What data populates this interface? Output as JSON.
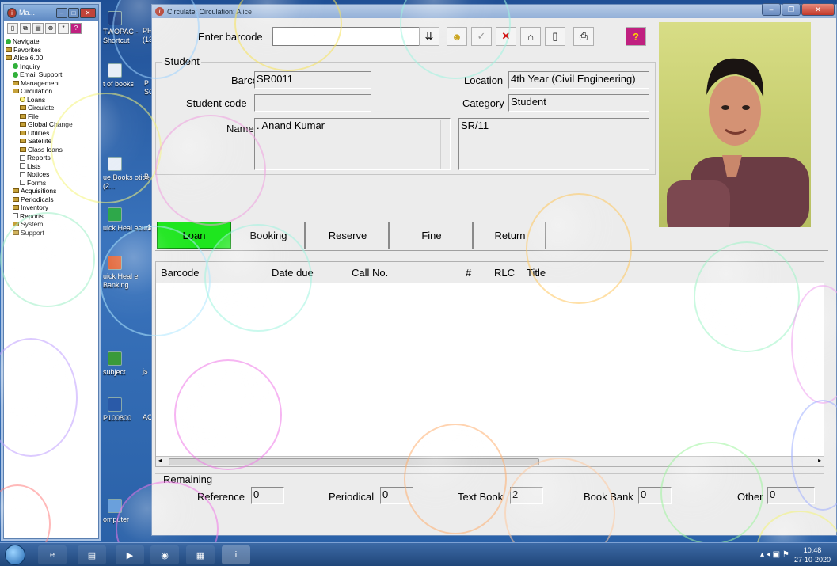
{
  "desktop": {
    "icons": [
      {
        "label": "TWOPAC - Shortcut",
        "extra": "PH (13"
      },
      {
        "label": "t of books",
        "extra": "P SO"
      },
      {
        "label": "ue Books otice (2...",
        "extra": "B"
      },
      {
        "label": "uick Heal ecure",
        "extra": "1"
      },
      {
        "label": "uick Heal e Banking",
        "extra": ""
      },
      {
        "label": "subject",
        "extra": "js"
      },
      {
        "label": "P100800",
        "extra": "AC"
      },
      {
        "label": "omputer",
        "extra": ""
      }
    ]
  },
  "tree_window": {
    "title": "Ma...",
    "items": [
      {
        "label": "Navigate",
        "icon": "green-dot-icon",
        "indent": 0
      },
      {
        "label": "Favorites",
        "icon": "folder-icon",
        "indent": 0
      },
      {
        "label": "Alice 6.00",
        "icon": "folder-icon",
        "indent": 0
      },
      {
        "label": "Inquiry",
        "icon": "green-dot-icon",
        "indent": 1
      },
      {
        "label": "Email Support",
        "icon": "green-dot-icon",
        "indent": 1
      },
      {
        "label": "Management",
        "icon": "folder-icon",
        "indent": 1
      },
      {
        "label": "Circulation",
        "icon": "folder-icon",
        "indent": 1
      },
      {
        "label": "Loans",
        "icon": "yellow-circle-icon",
        "indent": 2
      },
      {
        "label": "Circulate",
        "icon": "folder-icon",
        "indent": 2
      },
      {
        "label": "File",
        "icon": "folder-icon",
        "indent": 2
      },
      {
        "label": "Global Change",
        "icon": "folder-icon",
        "indent": 2
      },
      {
        "label": "Utilities",
        "icon": "folder-icon",
        "indent": 2
      },
      {
        "label": "Satellite",
        "icon": "folder-icon",
        "indent": 2
      },
      {
        "label": "Class loans",
        "icon": "folder-icon",
        "indent": 2
      },
      {
        "label": "Reports",
        "icon": "printer-icon",
        "indent": 2
      },
      {
        "label": "Lists",
        "icon": "printer-icon",
        "indent": 2
      },
      {
        "label": "Notices",
        "icon": "printer-icon",
        "indent": 2
      },
      {
        "label": "Forms",
        "icon": "printer-icon",
        "indent": 2
      },
      {
        "label": "Acquisitions",
        "icon": "folder-icon",
        "indent": 1
      },
      {
        "label": "Periodicals",
        "icon": "folder-icon",
        "indent": 1
      },
      {
        "label": "Inventory",
        "icon": "folder-icon",
        "indent": 1
      },
      {
        "label": "Reports",
        "icon": "printer-icon",
        "indent": 1
      },
      {
        "label": "System",
        "icon": "folder-icon",
        "indent": 1
      },
      {
        "label": "Support",
        "icon": "folder-icon",
        "indent": 1
      }
    ]
  },
  "main_window": {
    "title": "Circulate: Circulation: Alice",
    "enter_barcode_label": "Enter barcode",
    "barcode_input_value": "",
    "student_section_label": "Student",
    "fields": {
      "barcode_label": "Barcode",
      "barcode_value": "SR0011",
      "location_label": "Location",
      "location_value": "4th Year (Civil Engineering)",
      "student_code_label": "Student code",
      "student_code_value": "",
      "category_label": "Category",
      "category_value": "Student",
      "name_label": "Name",
      "name_value": ". Anand Kumar",
      "notes_value": "SR/11"
    },
    "tabs": [
      {
        "label": "Loan",
        "active": true
      },
      {
        "label": "Booking",
        "active": false
      },
      {
        "label": "Reserve",
        "active": false
      },
      {
        "label": "Fine",
        "active": false
      },
      {
        "label": "Return",
        "active": false
      }
    ],
    "list_headers": {
      "barcode": "Barcode",
      "date_due": "Date due",
      "call_no": "Call No.",
      "hash": "#",
      "rlc": "RLC",
      "title": "Title"
    },
    "remaining": {
      "label": "Remaining",
      "reference_label": "Reference",
      "reference_value": "0",
      "periodical_label": "Periodical",
      "periodical_value": "0",
      "textbook_label": "Text Book",
      "textbook_value": "2",
      "bookbank_label": "Book Bank",
      "bookbank_value": "0",
      "other_label": "Other",
      "other_value": "0"
    }
  },
  "taskbar": {
    "time": "10:48",
    "date": "27-10-2020"
  },
  "colors": {
    "active_tab": "#1ee61e",
    "title_bar": "#93b0d8",
    "desktop": "#2b5a9c"
  }
}
